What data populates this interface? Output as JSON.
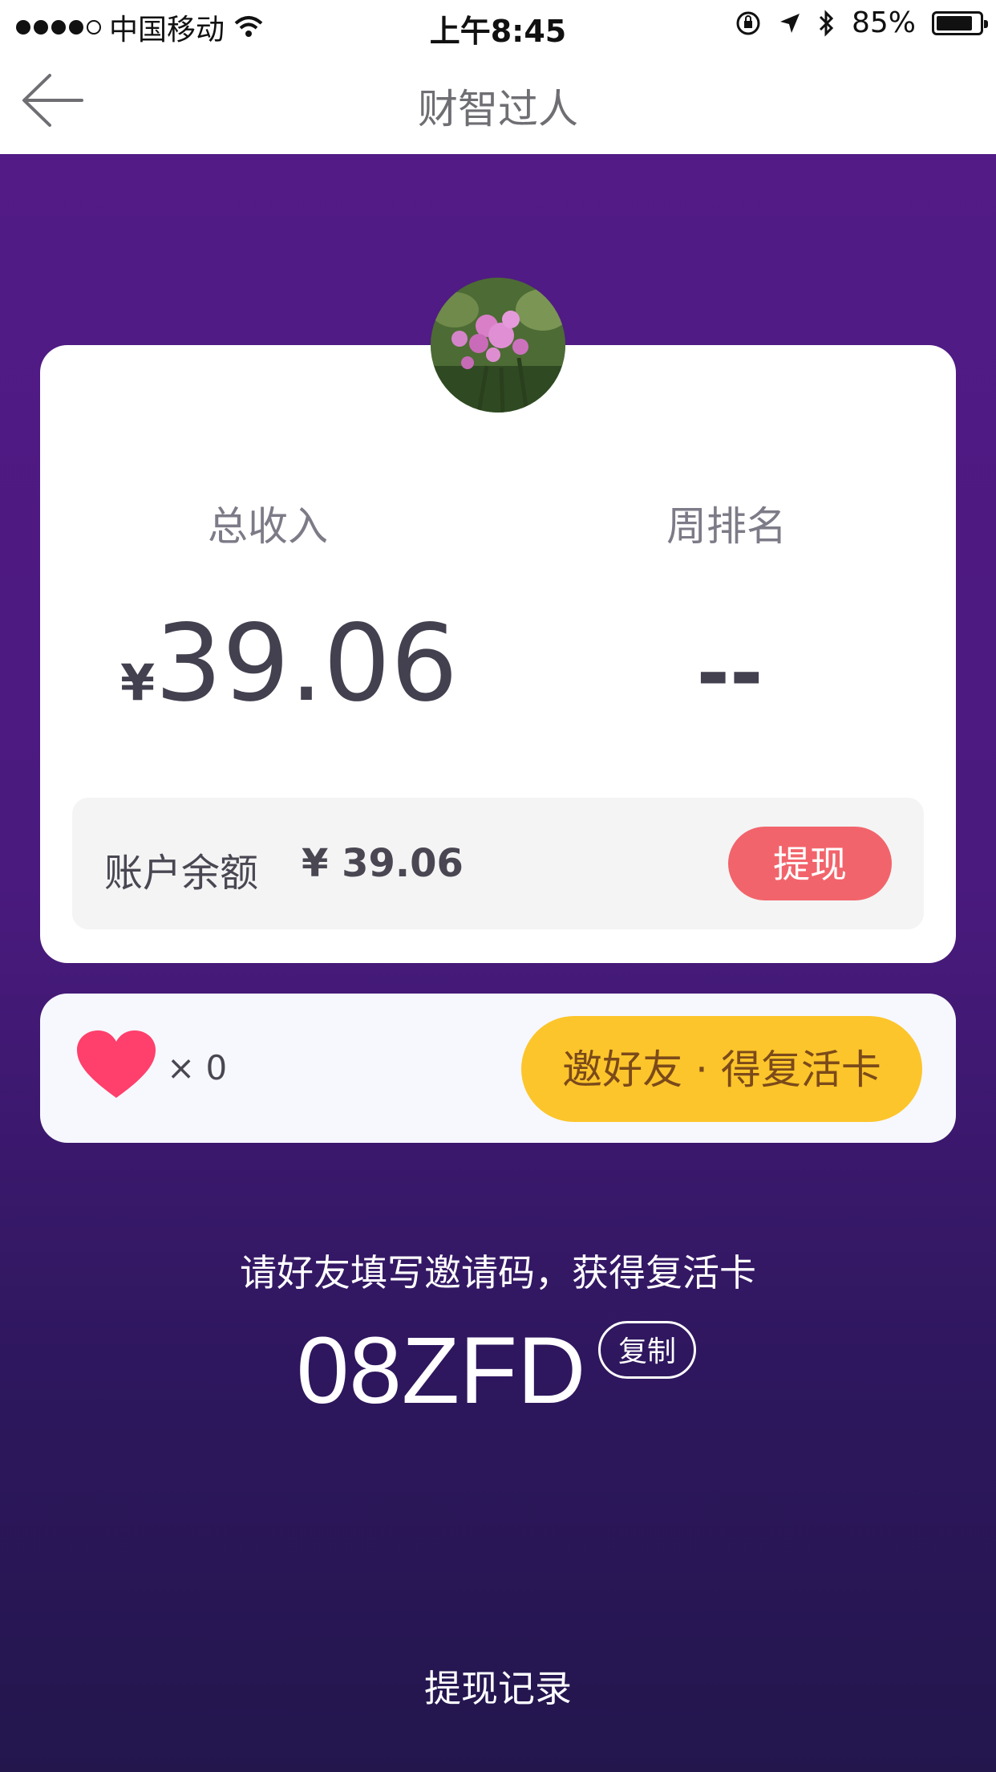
{
  "status_bar": {
    "carrier": "中国移动",
    "time": "上午8:45",
    "battery": "85%",
    "battery_level": 0.85
  },
  "nav": {
    "title": "财智过人",
    "back_icon": "back-arrow-icon"
  },
  "stats": {
    "income_label": "总收入",
    "income_currency": "¥",
    "income_value": "39.06",
    "rank_label": "周排名",
    "rank_value": "--"
  },
  "balance": {
    "label": "账户余额",
    "value": "¥ 39.06",
    "withdraw_label": "提现"
  },
  "lives": {
    "icon": "heart-icon",
    "count_text": "× 0",
    "invite_button_label": "邀好友 · 得复活卡"
  },
  "invite": {
    "instruction": "请好友填写邀请码，获得复活卡",
    "code": "08ZFD",
    "copy_label": "复制"
  },
  "footer": {
    "records_label": "提现记录"
  },
  "colors": {
    "purple_top": "#521b86",
    "purple_bottom": "#23164d",
    "withdraw_red": "#f2646b",
    "invite_yellow": "#fcc52b",
    "heart_pink": "#ff3f6c"
  }
}
